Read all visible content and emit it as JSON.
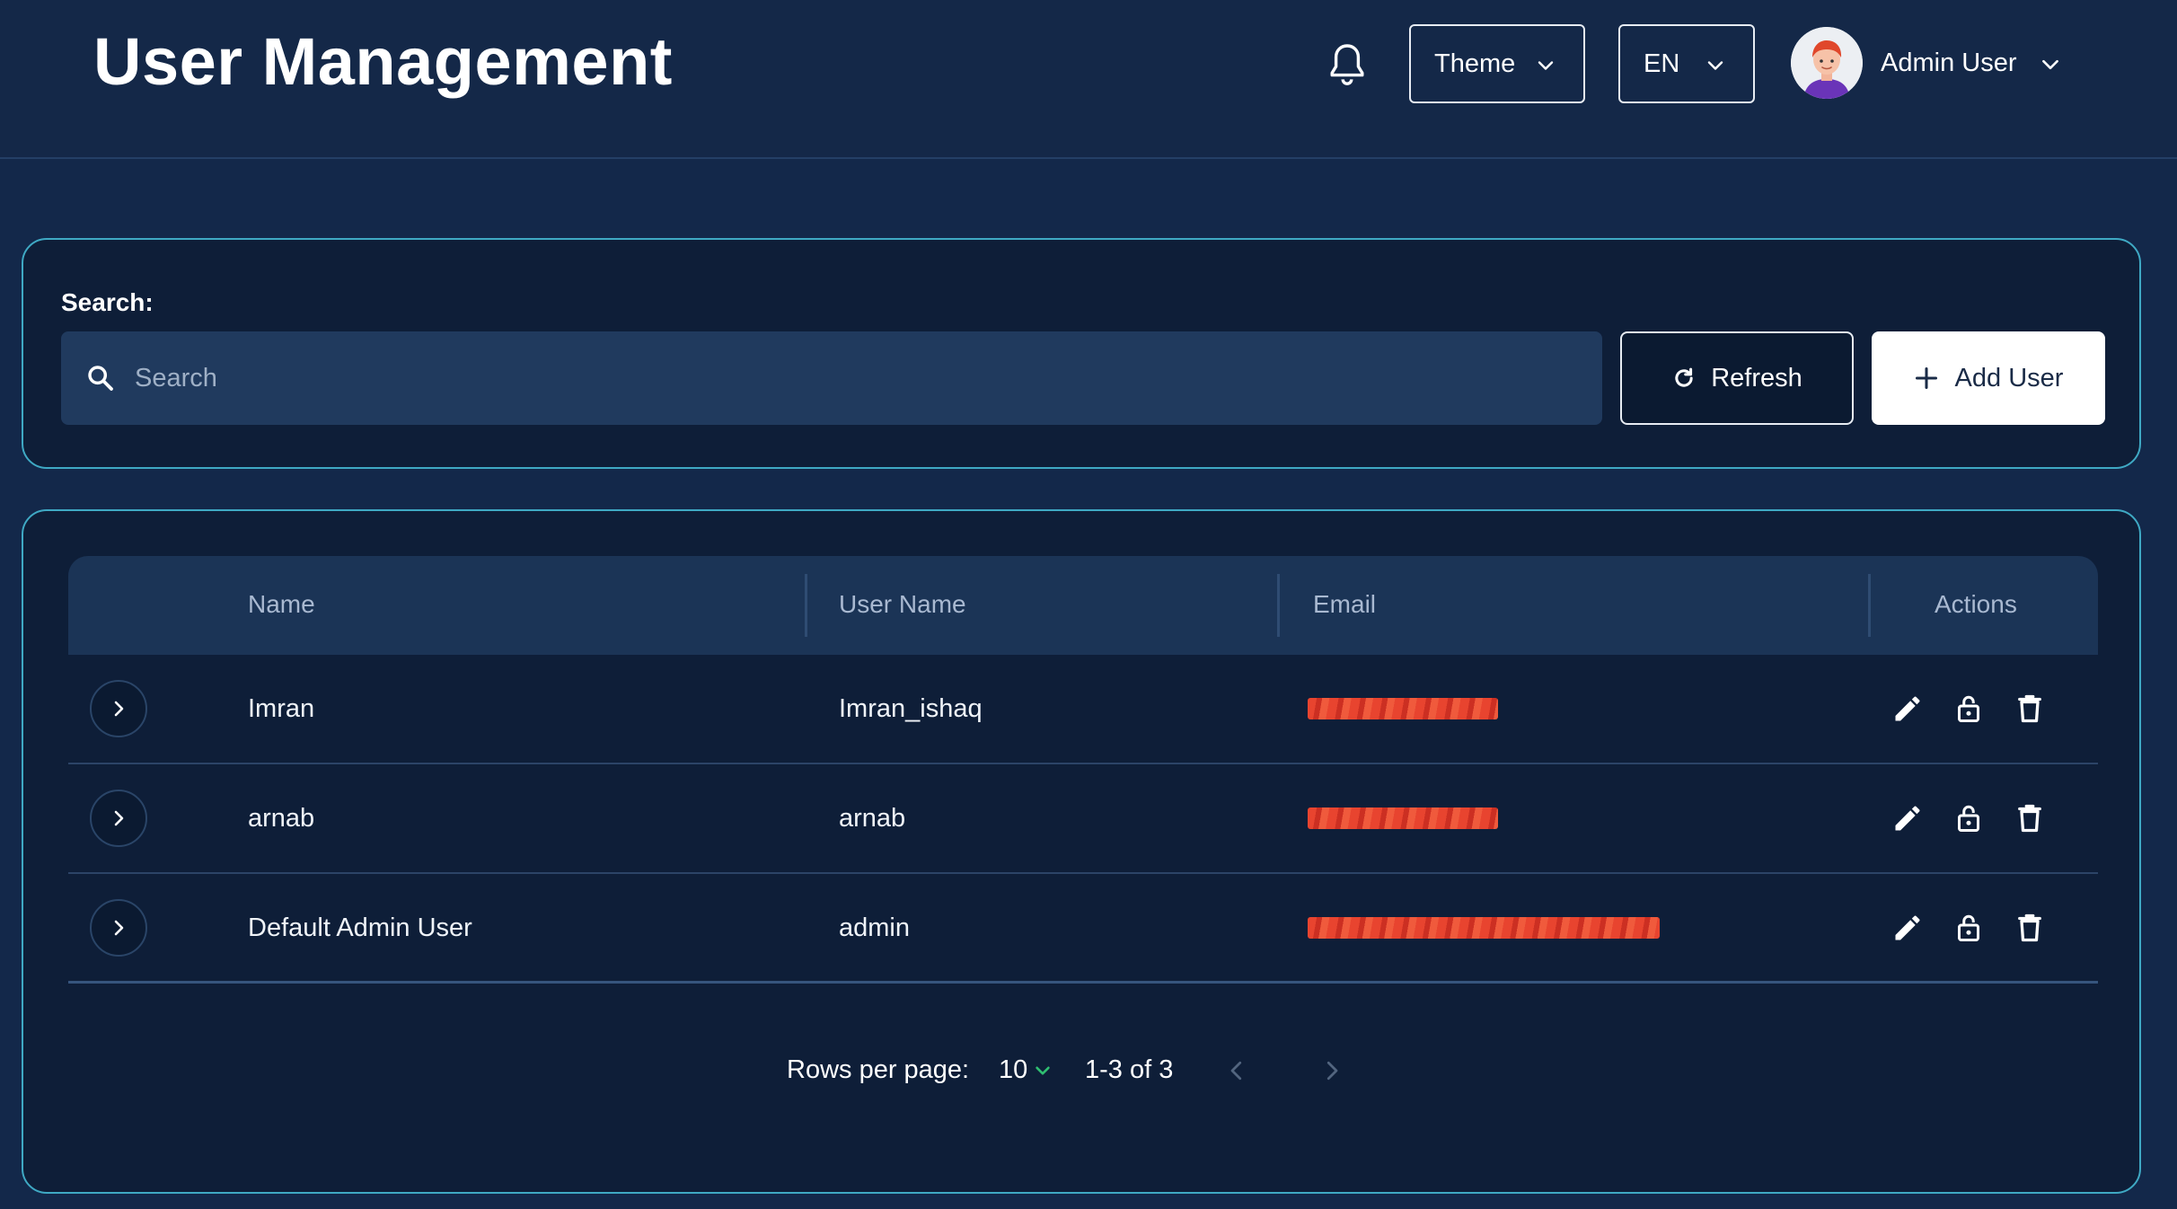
{
  "header": {
    "title": "User Management",
    "theme_label": "Theme",
    "lang_label": "EN",
    "user_name": "Admin User"
  },
  "search": {
    "label": "Search:",
    "placeholder": "Search",
    "value": "",
    "refresh_label": "Refresh",
    "add_label": "Add User"
  },
  "table": {
    "columns": [
      "Name",
      "User Name",
      "Email",
      "Actions"
    ],
    "rows": [
      {
        "name": "Imran",
        "username": "Imran_ishaq",
        "email_redacted": true
      },
      {
        "name": "arnab",
        "username": "arnab",
        "email_redacted": true
      },
      {
        "name": "Default Admin User",
        "username": "admin",
        "email_redacted": true
      }
    ]
  },
  "pagination": {
    "rows_per_page_label": "Rows per page:",
    "rows_per_page": "10",
    "range": "1-3 of 3"
  },
  "colors": {
    "background": "#13284a",
    "panel": "#0e1e38",
    "panel_border": "#3fa9c4",
    "table_header": "#1b3456",
    "redaction": "#e8442f",
    "rpp_chevron": "#2fbf71"
  },
  "icons": {
    "notification": "bell-icon",
    "search": "search-icon",
    "refresh": "refresh-icon",
    "add": "plus-icon",
    "expand": "chevron-right-icon",
    "edit": "pencil-icon",
    "lock": "lock-icon",
    "delete": "trash-icon"
  }
}
